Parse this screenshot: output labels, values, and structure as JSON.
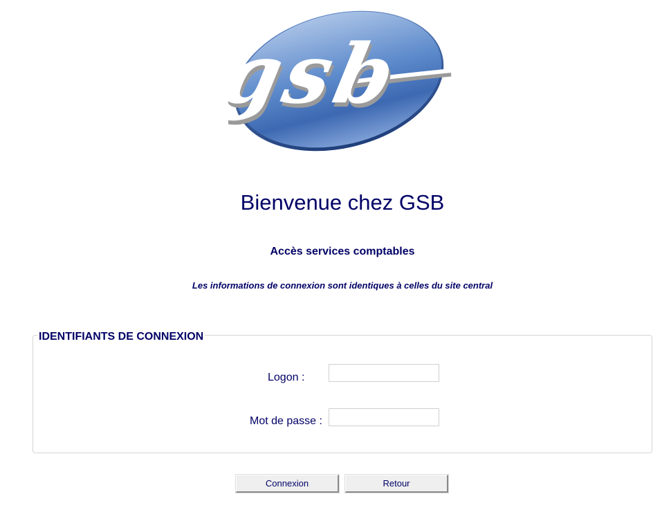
{
  "logo": {
    "text": "gsb",
    "colors": {
      "ellipse_light": "#9db8e0",
      "ellipse_dark": "#3a66b0",
      "letters": "#ffffff",
      "letters_shadow": "#9a9a9a"
    }
  },
  "header": {
    "welcome": "Bienvenue chez GSB",
    "subtitle": "Accès services comptables",
    "info": "Les informations de connexion sont identiques à celles du site central"
  },
  "form": {
    "legend": "IDENTIFIANTS DE CONNEXION",
    "logon_label": "Logon :",
    "logon_value": "",
    "password_label": "Mot de passe :",
    "password_value": ""
  },
  "buttons": {
    "connexion": "Connexion",
    "retour": "Retour"
  },
  "colors": {
    "text": "#000066",
    "fieldset_border": "#d4d4d4",
    "button_bg": "#efefef"
  }
}
